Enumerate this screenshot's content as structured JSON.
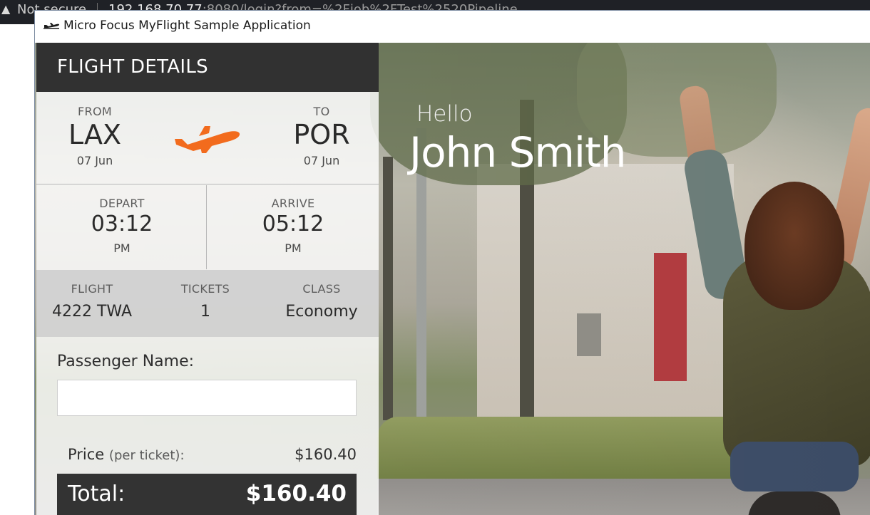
{
  "browser": {
    "warning_glyph": "▲",
    "security_text": "Not secure",
    "host": "192.168.70.77",
    "path": ":8080/login?from=%2Fjob%2FTest%2520Pipeline"
  },
  "window": {
    "title": "Micro Focus MyFlight Sample Application",
    "icon": "airplane-icon"
  },
  "hero": {
    "greeting": "Hello",
    "user_name": "John Smith"
  },
  "flight": {
    "header": "FLIGHT DETAILS",
    "from_label": "FROM",
    "from_code": "LAX",
    "from_date": "07 Jun",
    "to_label": "TO",
    "to_code": "POR",
    "to_date": "07 Jun",
    "plane_icon": "plane-icon",
    "plane_color": "#f26b1d",
    "depart_label": "DEPART",
    "depart_time": "03:12",
    "depart_ampm": "PM",
    "arrive_label": "ARRIVE",
    "arrive_time": "05:12",
    "arrive_ampm": "PM",
    "flight_label": "FLIGHT",
    "flight_value": "4222 TWA",
    "tickets_label": "TICKETS",
    "tickets_value": "1",
    "class_label": "CLASS",
    "class_value": "Economy"
  },
  "booking": {
    "passenger_label": "Passenger Name:",
    "passenger_value": "",
    "price_label": "Price",
    "price_note": "(per ticket):",
    "price_value": "$160.40",
    "total_label": "Total:",
    "total_value": "$160.40"
  }
}
